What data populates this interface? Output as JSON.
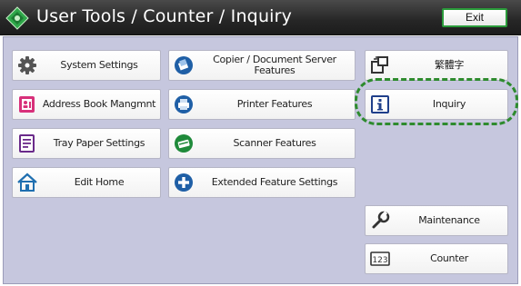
{
  "window": {
    "title": "User Tools / Counter / Inquiry",
    "exit_label": "Exit"
  },
  "menu": {
    "system_settings": "System Settings",
    "address_book": "Address Book Mangmnt",
    "tray_paper": "Tray Paper Settings",
    "edit_home": "Edit Home",
    "copier_features": "Copier / Document Server Features",
    "printer_features": "Printer Features",
    "scanner_features": "Scanner Features",
    "extended_features": "Extended Feature Settings",
    "language": "繁體字",
    "inquiry": "Inquiry",
    "maintenance": "Maintenance",
    "counter": "Counter",
    "counter_icon_text": "123"
  },
  "colors": {
    "panel_bg": "#c6c7de",
    "accent_green": "#2e8b2e",
    "titlebar": "#262626",
    "icon_blue": "#1f5fa6"
  },
  "icons": {
    "title": "user-tools-diamond-icon",
    "system_settings": "gear-icon",
    "address_book": "address-book-icon",
    "tray_paper": "document-icon",
    "edit_home": "home-icon",
    "copier_features": "copier-icon",
    "printer_features": "printer-icon",
    "scanner_features": "scanner-icon",
    "extended_features": "extended-features-icon",
    "language": "language-switch-icon",
    "inquiry": "info-icon",
    "maintenance": "wrench-icon",
    "counter": "counter-icon"
  }
}
